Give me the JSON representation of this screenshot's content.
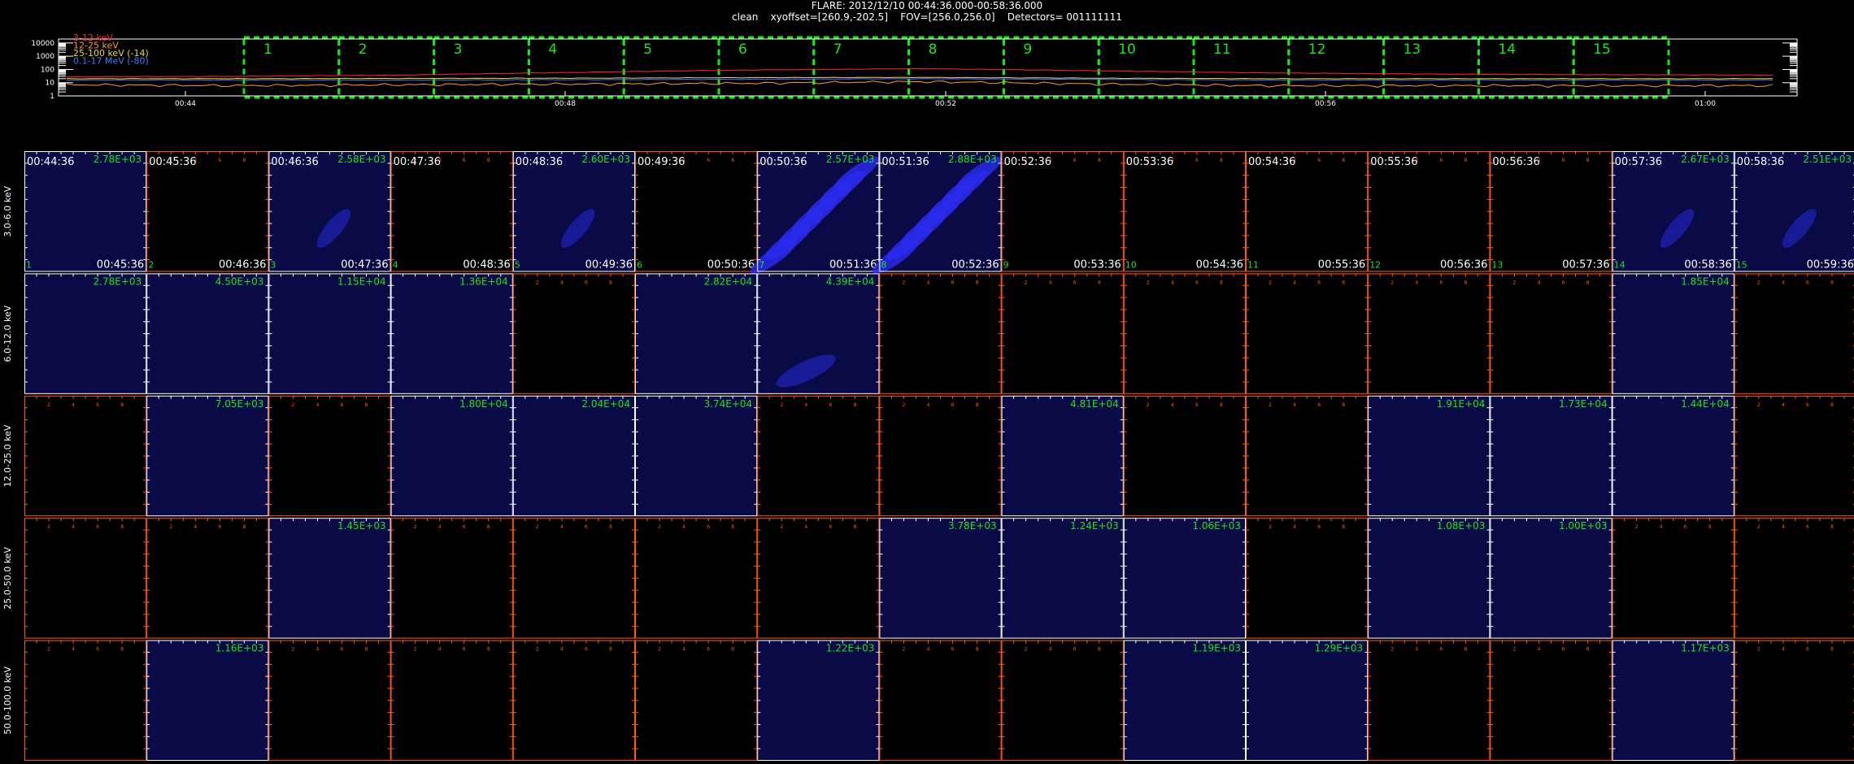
{
  "header": {
    "title": "FLARE: 2012/12/10 00:44:36.000-00:58:36.000",
    "subtitle": "clean    xyoffset=[260.9,-202.5]    FOV=[256.0,256.0]    Detectors= 001111111"
  },
  "colors": {
    "band_3_12": "#ff2a2a",
    "band_12_25": "#ff9a2a",
    "band_25_100": "#f2d43a",
    "band_100_17m": "#3d7bff",
    "interval_box": "#19e619",
    "frame_active": "#ffffff",
    "frame_empty": "#ff5a14",
    "label_green": "#19e619",
    "image_blue": "#0a0a46"
  },
  "chart_data": [
    {
      "type": "line",
      "title": "",
      "y_log": true,
      "ylim": [
        1,
        20000
      ],
      "y_ticks": [
        "1",
        "10",
        "100",
        "1000",
        "10000"
      ],
      "x_ticks": [
        "00:44",
        "00:48",
        "00:52",
        "00:56",
        "01:00"
      ],
      "series": [
        {
          "name": "3-12 keV",
          "values": [
            28,
            30,
            38,
            60,
            90,
            115,
            80,
            55,
            45,
            40,
            38
          ]
        },
        {
          "name": "12-25 keV",
          "values": [
            7,
            6,
            7,
            8,
            9,
            12,
            8,
            6,
            6,
            6,
            6
          ]
        },
        {
          "name": "25-100 keV (-14)",
          "values": [
            20,
            20,
            21,
            22,
            24,
            25,
            22,
            20,
            20,
            20,
            20
          ]
        },
        {
          "name": "0.1-17 MeV (-80)",
          "values": [
            16,
            16,
            16,
            17,
            18,
            20,
            18,
            16,
            16,
            16,
            16
          ]
        }
      ],
      "intervals": [
        "1",
        "2",
        "3",
        "4",
        "5",
        "6",
        "7",
        "8",
        "9",
        "10",
        "11",
        "12",
        "13",
        "14",
        "15"
      ]
    },
    {
      "type": "heatmap",
      "title": "",
      "energy_bands": [
        "3.0-6.0 keV",
        "6.0-12.0 keV",
        "12.0-25.0 keV",
        "25.0-50.0 keV",
        "50.0-100.0 keV"
      ],
      "start_times": [
        "00:44:36",
        "00:45:36",
        "00:46:36",
        "00:47:36",
        "00:48:36",
        "00:49:36",
        "00:50:36",
        "00:51:36",
        "00:52:36",
        "00:53:36",
        "00:54:36",
        "00:55:36",
        "00:56:36",
        "00:57:36",
        "00:58:36"
      ],
      "end_times": [
        "00:45:36",
        "00:46:36",
        "00:47:36",
        "00:48:36",
        "00:49:36",
        "00:50:36",
        "00:51:36",
        "00:52:36",
        "00:53:36",
        "00:54:36",
        "00:55:36",
        "00:56:36",
        "00:57:36",
        "00:58:36",
        "00:59:36"
      ],
      "interval_numbers": [
        "1",
        "2",
        "3",
        "4",
        "5",
        "6",
        "7",
        "8",
        "9",
        "10",
        "11",
        "12",
        "13",
        "14",
        "15"
      ],
      "max_values": [
        [
          "2.78E+03",
          "",
          "2.58E+03",
          "",
          "2.60E+03",
          "",
          "2.57E+03",
          "2.88E+03",
          "",
          "",
          "",
          "",
          "",
          "2.67E+03",
          "2.51E+03"
        ],
        [
          "2.78E+03",
          "4.50E+03",
          "1.15E+04",
          "1.36E+04",
          "",
          "2.82E+04",
          "4.39E+04",
          "",
          "",
          "",
          "",
          "",
          "",
          "1.85E+04",
          ""
        ],
        [
          "",
          "7.05E+03",
          "",
          "1.80E+04",
          "2.04E+04",
          "3.74E+04",
          "",
          "",
          "4.81E+04",
          "",
          "",
          "1.91E+04",
          "1.73E+04",
          "1.44E+04",
          ""
        ],
        [
          "",
          "",
          "1.45E+03",
          "",
          "",
          "",
          "",
          "3.78E+03",
          "1.24E+03",
          "1.06E+03",
          "",
          "1.08E+03",
          "1.00E+03",
          "",
          ""
        ],
        [
          "",
          "1.16E+03",
          "",
          "",
          "",
          "",
          "1.22E+03",
          "",
          "",
          "1.19E+03",
          "1.29E+03",
          "",
          "",
          "1.17E+03",
          ""
        ]
      ],
      "image_rows": [
        [
          1,
          0,
          1,
          0,
          1,
          0,
          1,
          1,
          0,
          0,
          0,
          0,
          0,
          1,
          1
        ],
        [
          1,
          1,
          1,
          1,
          0,
          1,
          1,
          0,
          0,
          0,
          0,
          0,
          0,
          1,
          0
        ],
        [
          0,
          1,
          0,
          1,
          1,
          1,
          0,
          0,
          1,
          0,
          0,
          1,
          1,
          1,
          0
        ],
        [
          0,
          0,
          1,
          0,
          0,
          0,
          0,
          1,
          1,
          1,
          0,
          1,
          1,
          0,
          0
        ],
        [
          0,
          1,
          0,
          0,
          0,
          0,
          1,
          0,
          0,
          1,
          1,
          0,
          0,
          1,
          0
        ]
      ],
      "frame_tick_labels": [
        "2",
        "4",
        "6",
        "8"
      ]
    }
  ]
}
